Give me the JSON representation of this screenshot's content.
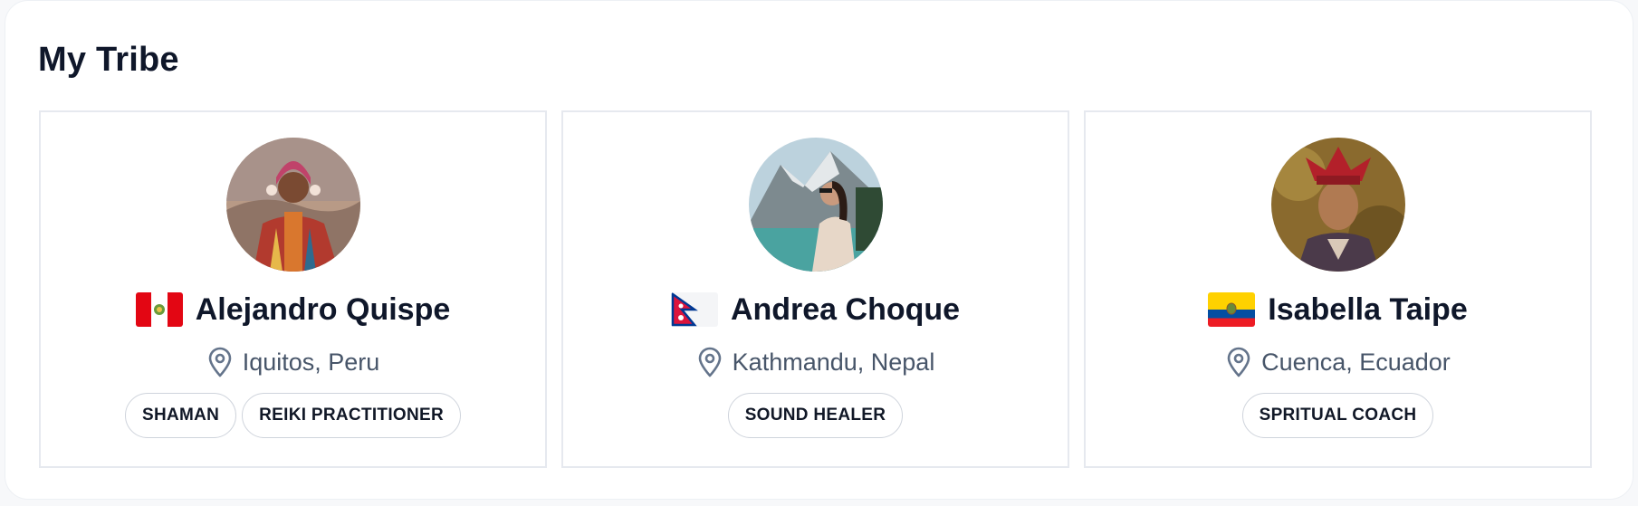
{
  "section": {
    "title": "My Tribe"
  },
  "members": [
    {
      "name": "Alejandro Quispe",
      "flag_icon": "peru-flag-icon",
      "location": "Iquitos, Peru",
      "tags": [
        "SHAMAN",
        "REIKI PRACTITIONER"
      ]
    },
    {
      "name": "Andrea Choque",
      "flag_icon": "nepal-flag-icon",
      "location": "Kathmandu, Nepal",
      "tags": [
        "SOUND HEALER"
      ]
    },
    {
      "name": "Isabella Taipe",
      "flag_icon": "ecuador-flag-icon",
      "location": "Cuenca, Ecuador",
      "tags": [
        "SPRITUAL COACH"
      ]
    }
  ],
  "icons": {
    "location": "map-pin-icon"
  },
  "colors": {
    "text_primary": "#0f172a",
    "text_secondary": "#475569",
    "border": "#e6e9ef",
    "tag_border": "#cfd4dc"
  }
}
